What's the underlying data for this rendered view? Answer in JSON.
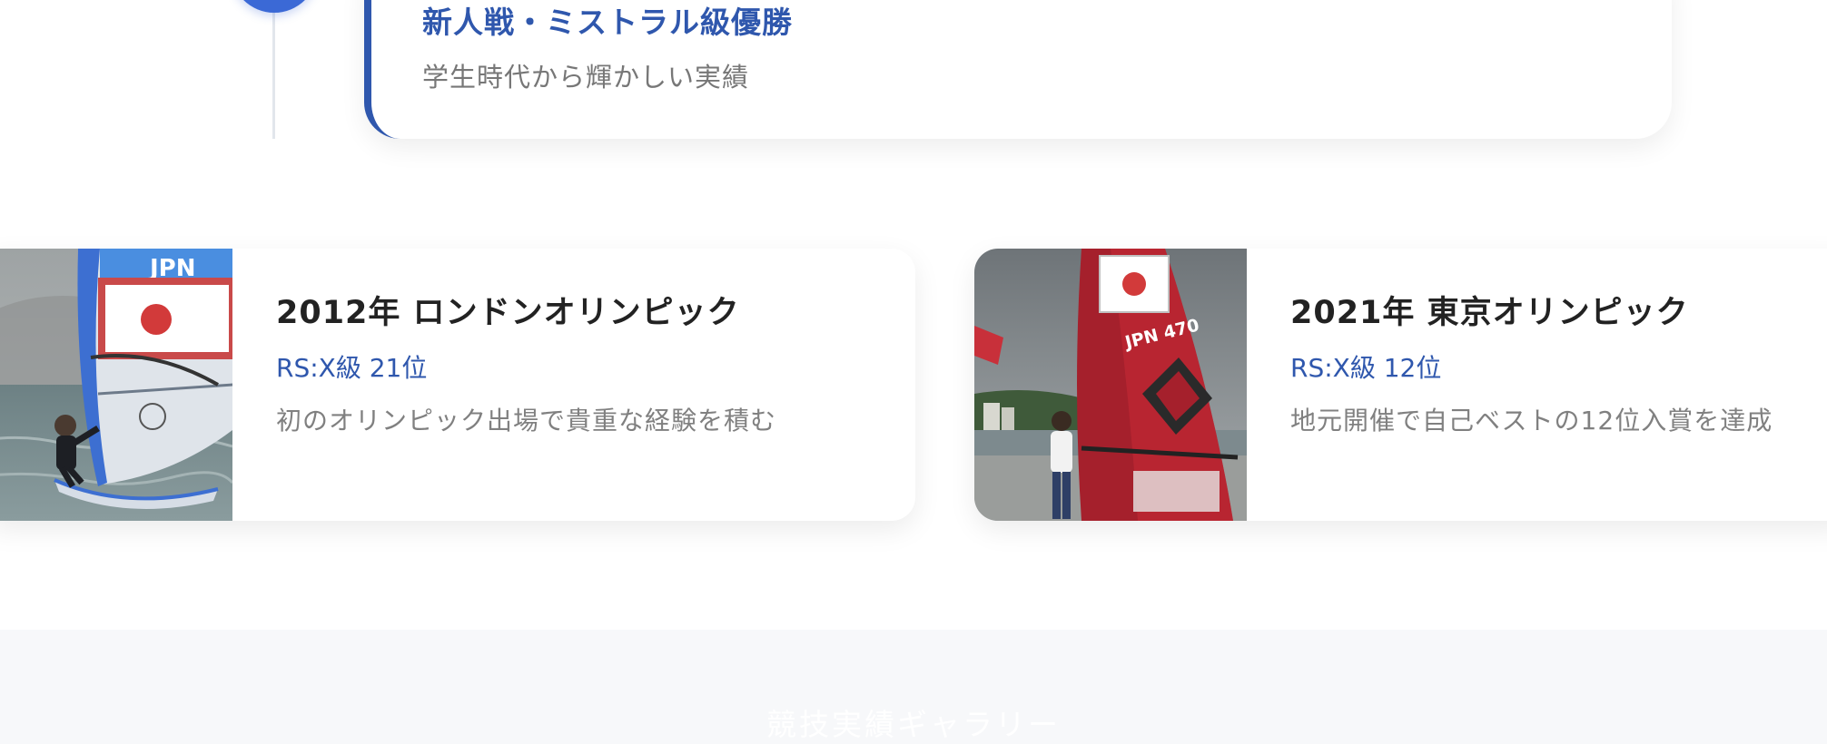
{
  "timeline": {
    "title": "新人戦・ミストラル級優勝",
    "description": "学生時代から輝かしい実績"
  },
  "olympics": [
    {
      "title": "2012年 ロンドンオリンピック",
      "result": "RS:X級 21位",
      "description": "初のオリンピック出場で貴重な経験を積む",
      "sail_text": "JPN"
    },
    {
      "title": "2021年 東京オリンピック",
      "result": "RS:X級 12位",
      "description": "地元開催で自己ベストの12位入賞を達成",
      "sail_text": "JPN 470"
    }
  ],
  "gallery": {
    "title": "競技実績ギャラリー"
  },
  "colors": {
    "accent": "#2f57ad",
    "dot": "#3b69d6",
    "muted_text": "#808080",
    "section_bg": "#f7f8fa"
  }
}
